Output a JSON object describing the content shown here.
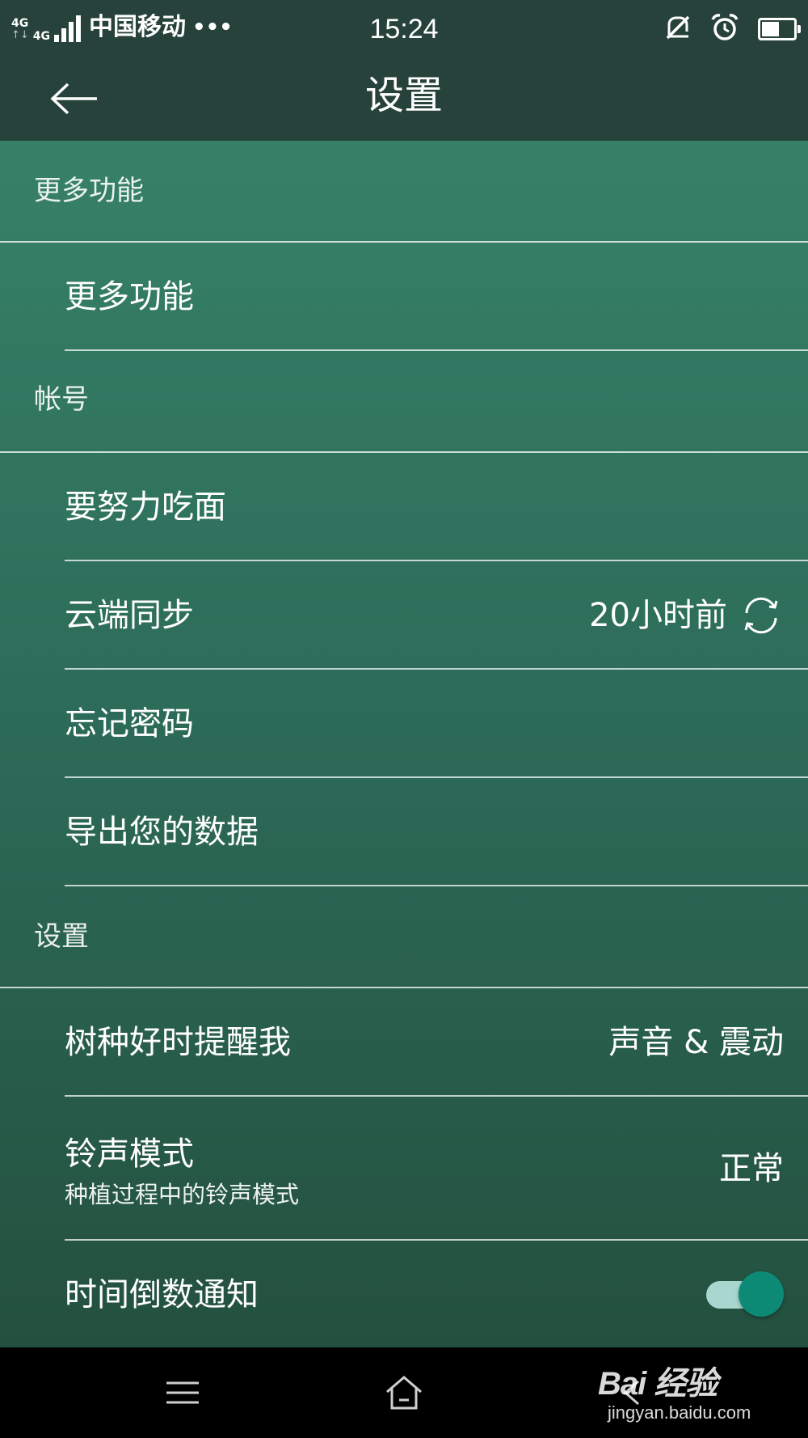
{
  "status_bar": {
    "network_a": "4G",
    "network_b": "4G",
    "carrier": "中国移动",
    "more_indicator": "•••",
    "time": "15:24",
    "icons": [
      "mute-icon",
      "alarm-icon",
      "battery-icon"
    ],
    "battery_level": 0.55
  },
  "app_bar": {
    "title": "设置",
    "back_icon": "arrow-left-icon"
  },
  "sections": [
    {
      "header": "更多功能",
      "rows": [
        {
          "label": "更多功能"
        }
      ]
    },
    {
      "header": "帐号",
      "rows": [
        {
          "label": "要努力吃面"
        },
        {
          "label": "云端同步",
          "value": "20小时前",
          "icon": "sync-icon"
        },
        {
          "label": "忘记密码"
        },
        {
          "label": "导出您的数据"
        }
      ]
    },
    {
      "header": "设置",
      "rows": [
        {
          "label": "树种好时提醒我",
          "value": "声音 & 震动"
        },
        {
          "label": "铃声模式",
          "sublabel": "种植过程中的铃声模式",
          "value": "正常"
        },
        {
          "label": "时间倒数通知",
          "toggle": true
        }
      ]
    }
  ],
  "nav_bar": {
    "icons": [
      "menu-icon",
      "home-icon",
      "back-icon"
    ]
  },
  "watermark": {
    "logo": "Bai 经验",
    "url": "jingyan.baidu.com"
  },
  "colors": {
    "top_bar": "#26423a",
    "content_top": "#378168",
    "content_bottom": "#24503f",
    "toggle_thumb": "#0d8a76",
    "toggle_track": "#a9d6cf"
  }
}
